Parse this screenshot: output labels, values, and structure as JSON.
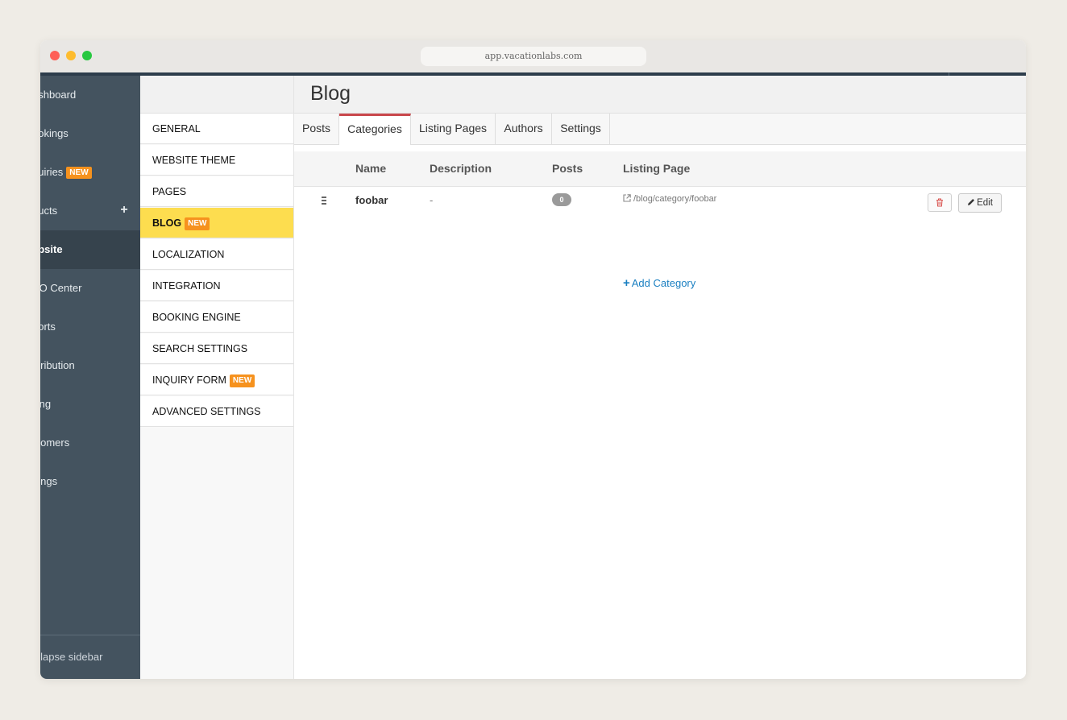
{
  "browser": {
    "url": "app.vacationlabs.com"
  },
  "sidebar": {
    "items": [
      {
        "label": "ashboard"
      },
      {
        "label": "ookings"
      },
      {
        "label": "quiries",
        "badge": "NEW"
      },
      {
        "label": "ducts"
      },
      {
        "label": "ebsite"
      },
      {
        "label": "EO Center"
      },
      {
        "label": "ports"
      },
      {
        "label": "stribution"
      },
      {
        "label": "lling"
      },
      {
        "label": "stomers"
      },
      {
        "label": "ttings"
      }
    ],
    "collapse_label": "ollapse sidebar"
  },
  "submenu": {
    "items": [
      {
        "label": "GENERAL"
      },
      {
        "label": "WEBSITE THEME"
      },
      {
        "label": "PAGES"
      },
      {
        "label": "BLOG",
        "badge": "NEW"
      },
      {
        "label": "LOCALIZATION"
      },
      {
        "label": "INTEGRATION"
      },
      {
        "label": "BOOKING ENGINE"
      },
      {
        "label": "SEARCH SETTINGS"
      },
      {
        "label": "INQUIRY FORM",
        "badge": "NEW"
      },
      {
        "label": "ADVANCED SETTINGS"
      }
    ]
  },
  "main": {
    "title": "Blog",
    "tabs": [
      {
        "label": "Posts"
      },
      {
        "label": "Categories"
      },
      {
        "label": "Listing Pages"
      },
      {
        "label": "Authors"
      },
      {
        "label": "Settings"
      }
    ],
    "table": {
      "columns": [
        "Name",
        "Description",
        "Posts",
        "Listing Page"
      ],
      "rows": [
        {
          "name": "foobar",
          "description": "-",
          "posts": "0",
          "listing_page": "/blog/category/foobar"
        }
      ],
      "edit_label": "Edit"
    },
    "add_category_label": "Add Category"
  },
  "colors": {
    "sidebar": "#44535f",
    "active_submenu": "#fddd4f",
    "badge": "#f6921e",
    "active_tab_accent": "#c9474b",
    "link": "#1a7fc1"
  }
}
